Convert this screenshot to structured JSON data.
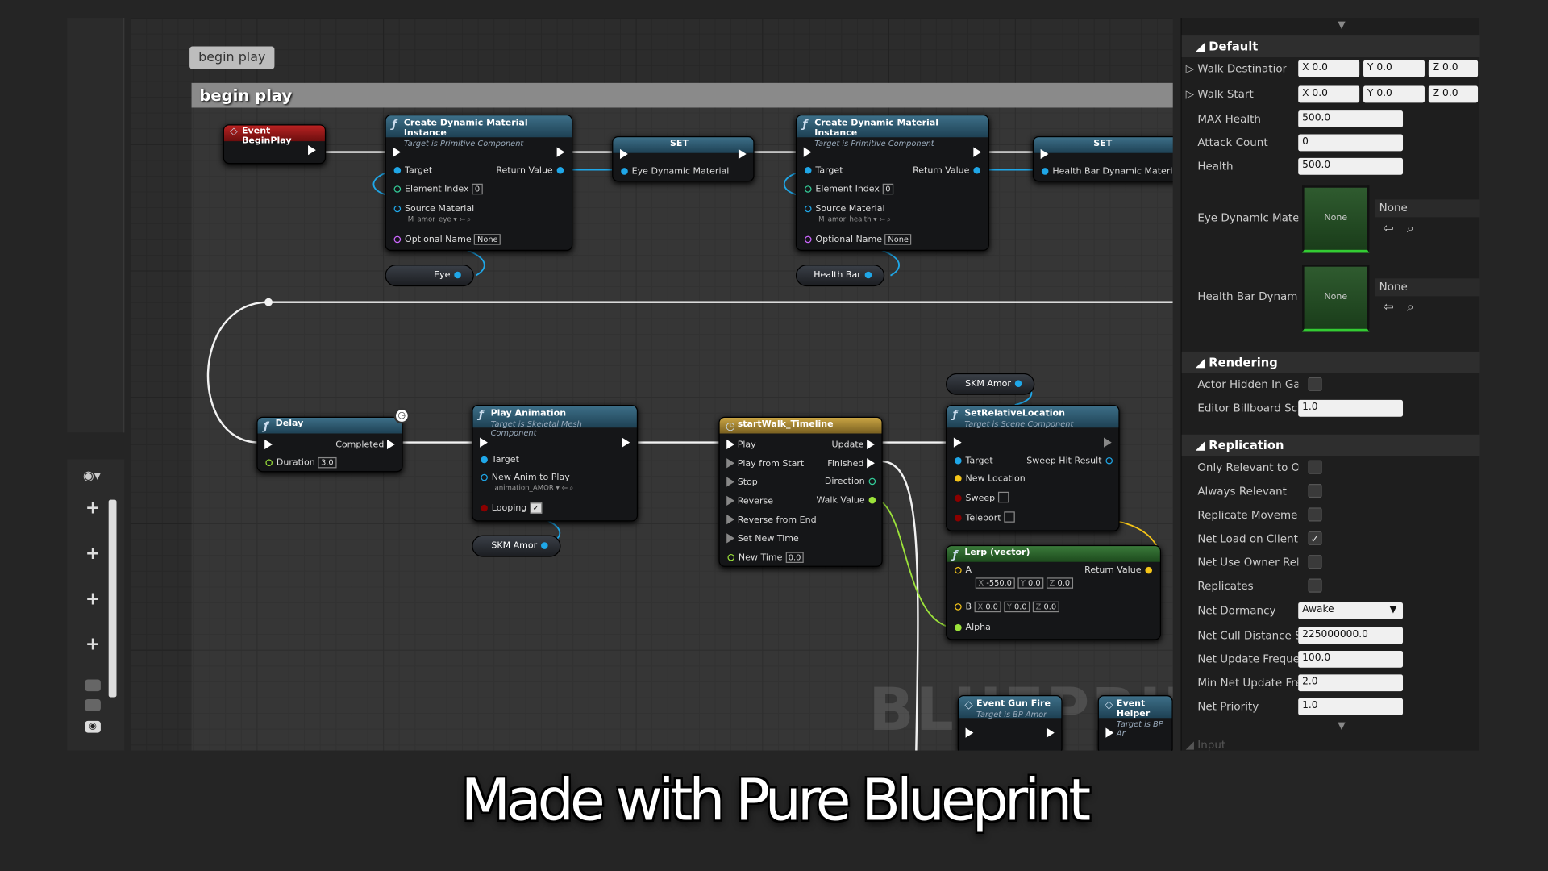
{
  "comment": {
    "bubble": "begin play",
    "header": "begin play"
  },
  "watermark": "BLUEPRINT",
  "caption": "Made with Pure Blueprint",
  "nodes": {
    "begin_play": {
      "title": "Event BeginPlay"
    },
    "cdmi1": {
      "title": "Create Dynamic Material Instance",
      "subtitle": "Target is Primitive Component",
      "target": "Target",
      "return_value": "Return Value",
      "element_index": "Element Index",
      "element_index_value": "0",
      "source_material": "Source Material",
      "source_material_value": "M_amor_eye",
      "optional_name": "Optional Name",
      "optional_name_value": "None"
    },
    "set1": {
      "title": "SET",
      "var": "Eye Dynamic Material"
    },
    "cdmi2": {
      "title": "Create Dynamic Material Instance",
      "subtitle": "Target is Primitive Component",
      "target": "Target",
      "return_value": "Return Value",
      "element_index": "Element Index",
      "element_index_value": "0",
      "source_material": "Source Material",
      "source_material_value": "M_amor_health",
      "optional_name": "Optional Name",
      "optional_name_value": "None"
    },
    "set2": {
      "title": "SET",
      "var": "Health Bar Dynamic Material"
    },
    "eye_var": {
      "label": "Eye"
    },
    "healthbar_var": {
      "label": "Health Bar"
    },
    "delay": {
      "title": "Delay",
      "completed": "Completed",
      "duration": "Duration",
      "duration_value": "3.0"
    },
    "play_anim": {
      "title": "Play Animation",
      "subtitle": "Target is Skeletal Mesh Component",
      "target": "Target",
      "new_anim": "New Anim to Play",
      "new_anim_value": "animation_AMOR",
      "looping": "Looping",
      "looping_check": "✓"
    },
    "skm_var1": {
      "label": "SKM Amor"
    },
    "skm_var2": {
      "label": "SKM Amor"
    },
    "timeline": {
      "title": "startWalk_Timeline",
      "play": "Play",
      "play_from_start": "Play from Start",
      "stop": "Stop",
      "reverse": "Reverse",
      "reverse_from_end": "Reverse from End",
      "set_new_time": "Set New Time",
      "new_time": "New Time",
      "new_time_value": "0.0",
      "update": "Update",
      "finished": "Finished",
      "direction": "Direction",
      "walk_value": "Walk Value"
    },
    "set_rel_loc": {
      "title": "SetRelativeLocation",
      "subtitle": "Target is Scene Component",
      "target": "Target",
      "sweep_hit": "Sweep Hit Result",
      "new_location": "New Location",
      "sweep": "Sweep",
      "teleport": "Teleport"
    },
    "lerp": {
      "title": "Lerp (vector)",
      "a": "A",
      "b": "B",
      "alpha": "Alpha",
      "return_value": "Return Value",
      "ax": "-550.0",
      "ay": "0.0",
      "az": "0.0",
      "bx": "0.0",
      "by": "0.0",
      "bz": "0.0",
      "x": "X",
      "y": "Y",
      "z": "Z"
    },
    "gun_fire": {
      "title": "Event Gun Fire",
      "subtitle": "Target is BP Amor"
    },
    "helper": {
      "title": "Event Helper",
      "subtitle": "Target is BP Ar"
    }
  },
  "details": {
    "default_label": "Default",
    "walk_destination": {
      "label": "Walk Destination",
      "x": "X",
      "xv": "0.0",
      "y": "Y",
      "yv": "0.0",
      "z": "Z",
      "zv": "0.0"
    },
    "walk_start": {
      "label": "Walk Start",
      "x": "X",
      "xv": "0.0",
      "y": "Y",
      "yv": "0.0",
      "z": "Z",
      "zv": "0.0"
    },
    "max_health": {
      "label": "MAX Health",
      "value": "500.0"
    },
    "attack_count": {
      "label": "Attack Count",
      "value": "0"
    },
    "health": {
      "label": "Health",
      "value": "500.0"
    },
    "eye_dynamic": {
      "label": "Eye Dynamic Mate",
      "thumb": "None",
      "value": "None"
    },
    "health_bar_dynamic": {
      "label": "Health Bar Dynami",
      "thumb": "None",
      "value": "None"
    },
    "rendering_label": "Rendering",
    "actor_hidden": {
      "label": "Actor Hidden In Ga"
    },
    "editor_billboard": {
      "label": "Editor Billboard Sc",
      "value": "1.0"
    },
    "replication_label": "Replication",
    "only_relevant": {
      "label": "Only Relevant to O"
    },
    "always_relevant": {
      "label": "Always Relevant"
    },
    "replicate_movement": {
      "label": "Replicate Moveme"
    },
    "net_load": {
      "label": "Net Load on Client",
      "check": "✓"
    },
    "net_use_owner": {
      "label": "Net Use Owner Rel"
    },
    "replicates": {
      "label": "Replicates"
    },
    "net_dormancy": {
      "label": "Net Dormancy",
      "value": "Awake"
    },
    "net_cull": {
      "label": "Net Cull Distance S",
      "value": "225000000.0"
    },
    "net_update_freq": {
      "label": "Net Update Frequer",
      "value": "100.0"
    },
    "min_net_update": {
      "label": "Min Net Update Fre",
      "value": "2.0"
    },
    "net_priority": {
      "label": "Net Priority",
      "value": "1.0"
    },
    "input_label": "Input"
  },
  "colors": {
    "exec": "#ffffff",
    "object_pin": "#1fa7e8",
    "vector_pin": "#f5c518",
    "float_pin": "#9be23a",
    "bool_pin": "#8b0000",
    "event_header": "#9b1b1b",
    "function_header": "#2a5a73",
    "timeline_header": "#a88a2a",
    "lerp_header": "#2d6a2d"
  }
}
